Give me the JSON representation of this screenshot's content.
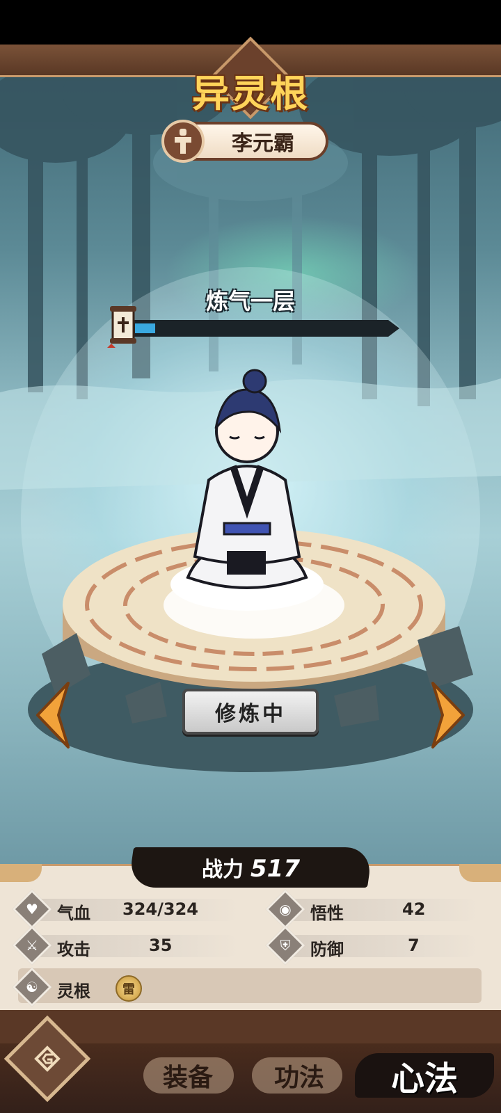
{
  "header": {
    "title": "异灵根",
    "character_name": "李元霸"
  },
  "cultivation": {
    "realm": "炼气一层",
    "progress": 0.08
  },
  "actions": {
    "train_label": "修炼中"
  },
  "power": {
    "label": "战力",
    "value": "517"
  },
  "stats": {
    "hp": {
      "name": "气血",
      "value": "324/324",
      "icon": "heart-icon"
    },
    "comprehension": {
      "name": "悟性",
      "value": "42",
      "icon": "eye-icon"
    },
    "attack": {
      "name": "攻击",
      "value": "35",
      "icon": "sword-icon"
    },
    "defense": {
      "name": "防御",
      "value": "7",
      "icon": "shield-icon"
    },
    "root": {
      "name": "灵根",
      "badge": "雷",
      "icon": "yinyang-icon"
    }
  },
  "nav": {
    "tabs": [
      {
        "label": "装备",
        "active": false
      },
      {
        "label": "功法",
        "active": false
      },
      {
        "label": "心法",
        "active": true
      }
    ]
  },
  "colors": {
    "title_gold": "#ffd45a",
    "frame_brown": "#6b412c",
    "xp_fill": "#3aa9e0",
    "panel_bg": "#eee4d6"
  }
}
